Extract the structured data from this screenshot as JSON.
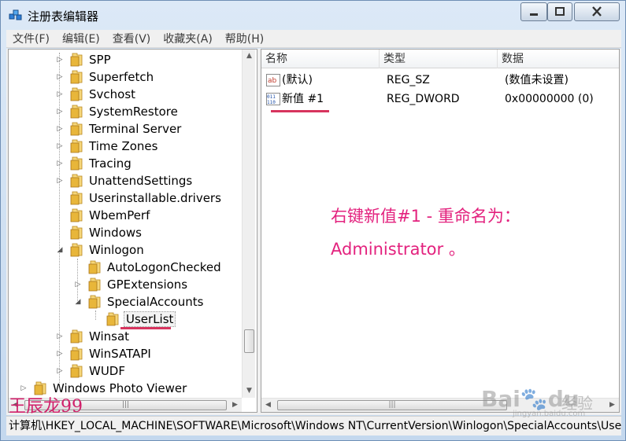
{
  "window": {
    "title": "注册表编辑器"
  },
  "menu": [
    "文件(F)",
    "编辑(E)",
    "查看(V)",
    "收藏夹(A)",
    "帮助(H)"
  ],
  "tree": [
    {
      "label": "SPP",
      "level": 1,
      "expander": "collapsed"
    },
    {
      "label": "Superfetch",
      "level": 1,
      "expander": "collapsed"
    },
    {
      "label": "Svchost",
      "level": 1,
      "expander": "collapsed"
    },
    {
      "label": "SystemRestore",
      "level": 1,
      "expander": "collapsed"
    },
    {
      "label": "Terminal Server",
      "level": 1,
      "expander": "collapsed"
    },
    {
      "label": "Time Zones",
      "level": 1,
      "expander": "collapsed"
    },
    {
      "label": "Tracing",
      "level": 1,
      "expander": "collapsed"
    },
    {
      "label": "UnattendSettings",
      "level": 1,
      "expander": "collapsed"
    },
    {
      "label": "Userinstallable.drivers",
      "level": 1,
      "expander": "none"
    },
    {
      "label": "WbemPerf",
      "level": 1,
      "expander": "none"
    },
    {
      "label": "Windows",
      "level": 1,
      "expander": "none"
    },
    {
      "label": "Winlogon",
      "level": 1,
      "expander": "expanded"
    },
    {
      "label": "AutoLogonChecked",
      "level": 2,
      "expander": "none"
    },
    {
      "label": "GPExtensions",
      "level": 2,
      "expander": "collapsed"
    },
    {
      "label": "SpecialAccounts",
      "level": 2,
      "expander": "expanded"
    },
    {
      "label": "UserList",
      "level": 3,
      "expander": "none",
      "selected": true
    },
    {
      "label": "Winsat",
      "level": 1,
      "expander": "collapsed"
    },
    {
      "label": "WinSATAPI",
      "level": 1,
      "expander": "collapsed"
    },
    {
      "label": "WUDF",
      "level": 1,
      "expander": "collapsed"
    },
    {
      "label": "Windows Photo Viewer",
      "level": 0,
      "expander": "collapsed"
    }
  ],
  "list": {
    "headers": {
      "name": "名称",
      "type": "类型",
      "data": "数据"
    },
    "rows": [
      {
        "icon": "string-value-icon",
        "name": "(默认)",
        "type": "REG_SZ",
        "data": "(数值未设置)"
      },
      {
        "icon": "dword-value-icon",
        "name": "新值 #1",
        "type": "REG_DWORD",
        "data": "0x00000000 (0)"
      }
    ]
  },
  "annotation": {
    "line1": "右键新值#1 - 重命名为：",
    "line2": "Administrator  。"
  },
  "status": "计算机\\HKEY_LOCAL_MACHINE\\SOFTWARE\\Microsoft\\Windows NT\\CurrentVersion\\Winlogon\\SpecialAccounts\\UserList",
  "watermarks": {
    "author": "王辰龙99",
    "baidu": "Bai",
    "baidu_paw": "du",
    "baidu_sub": "经验",
    "baidu_url": "jingyan.baidu.com"
  },
  "colors": {
    "annotation": "#e3227e",
    "underline": "#d7345e",
    "folder": "#e8b63a"
  }
}
